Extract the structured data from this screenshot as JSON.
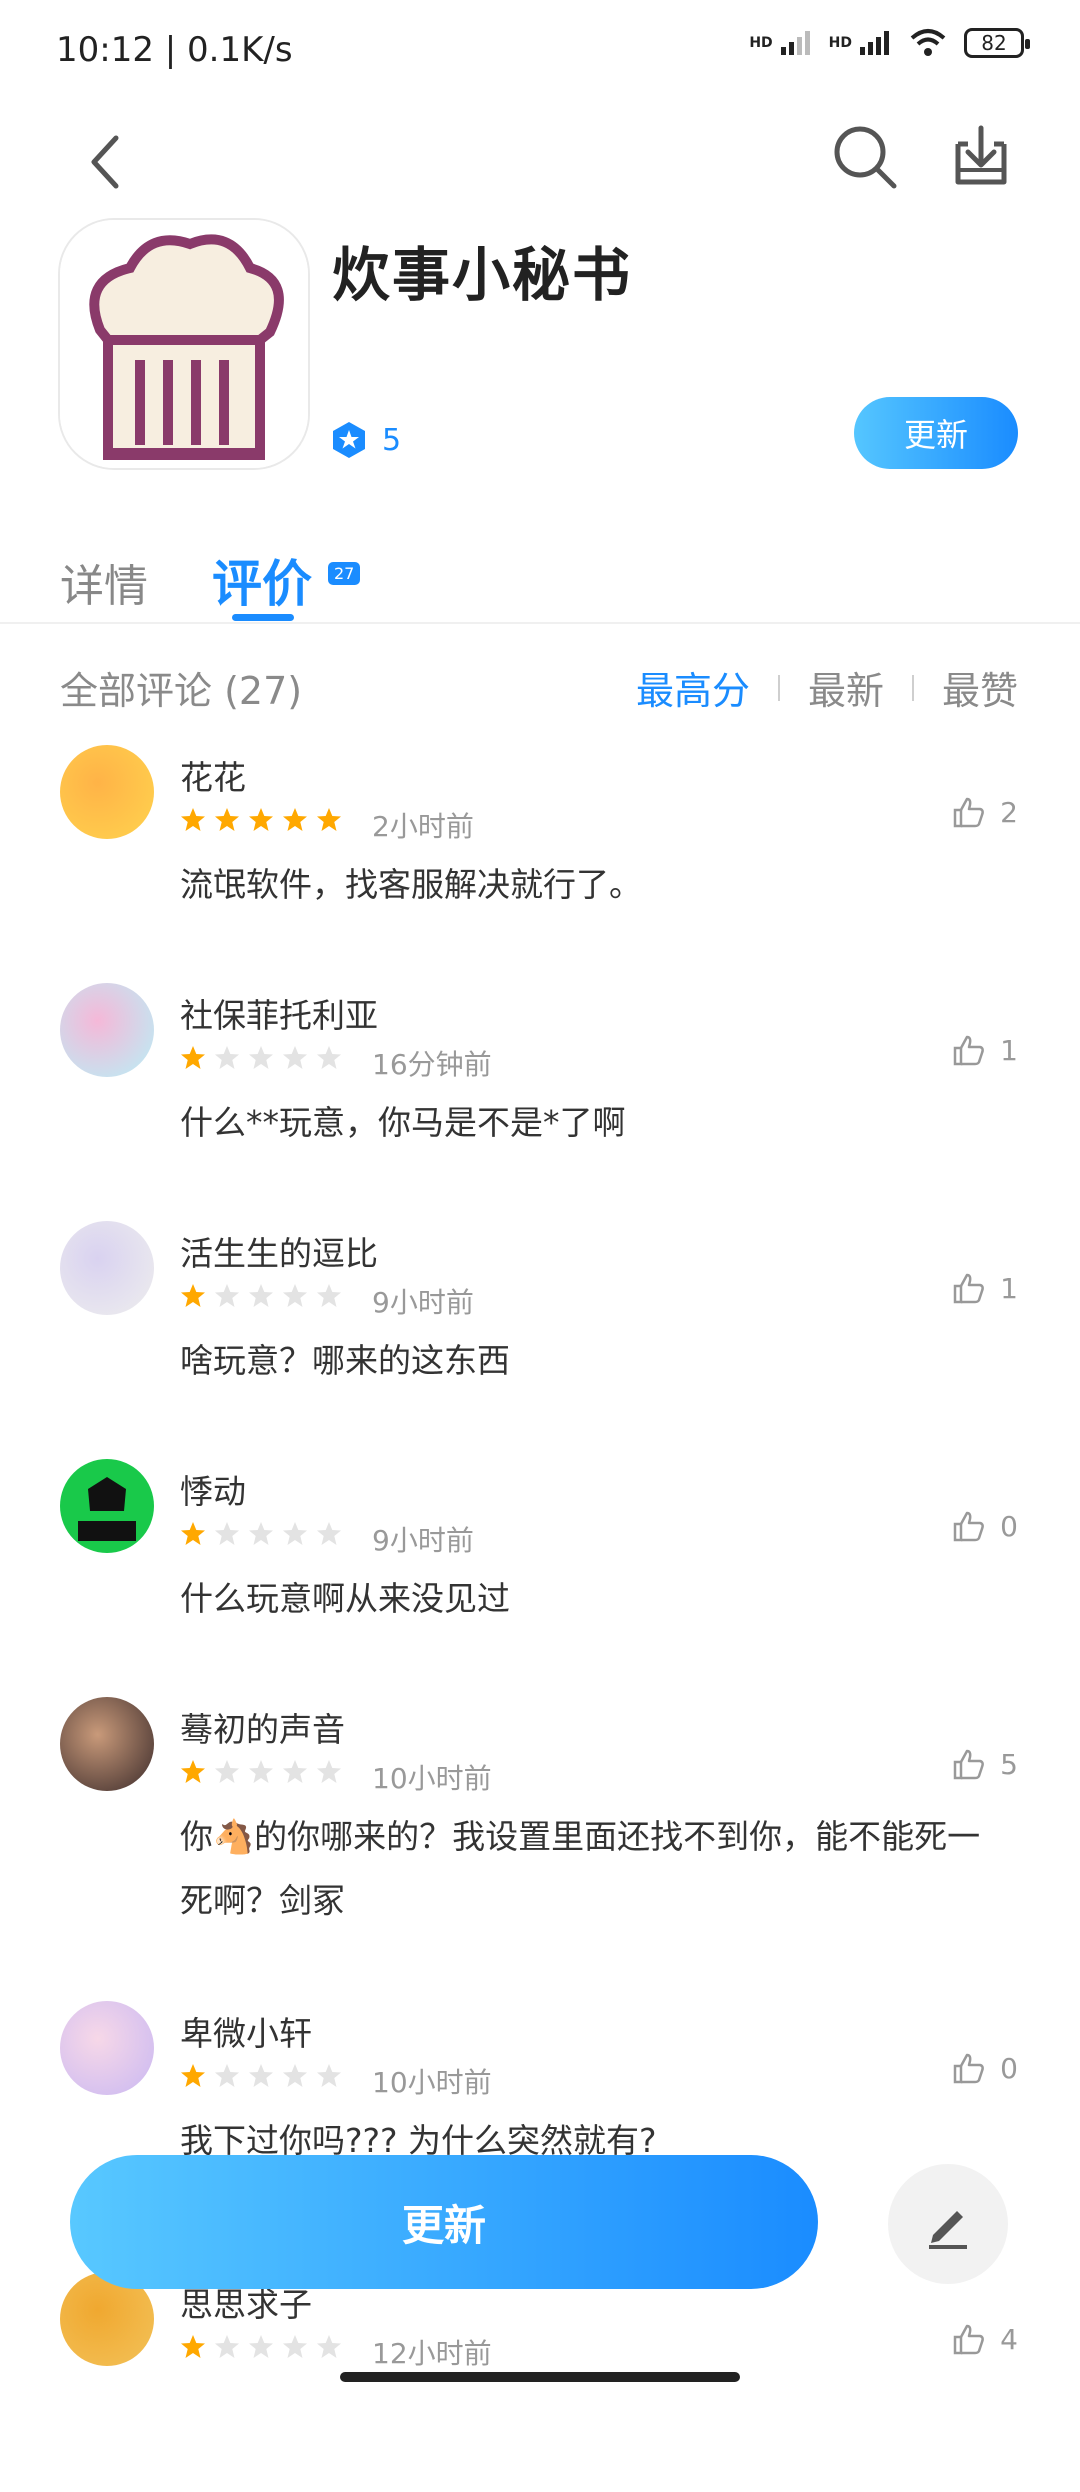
{
  "status_bar": {
    "time": "10:12 | 0.1K/s",
    "battery": "82",
    "hd1": "HD",
    "hd2": "HD"
  },
  "app": {
    "name": "炊事小秘书",
    "rating_badge": "5",
    "update_label": "更新"
  },
  "tabs": {
    "detail": "详情",
    "review": "评价",
    "review_count": "27"
  },
  "filters": {
    "all_label": "全部评论 (27)",
    "options": [
      "最高分",
      "最新",
      "最赞"
    ],
    "active": "最高分"
  },
  "reviews": [
    {
      "name": "花花",
      "stars": 5,
      "time": "2小时前",
      "content": "流氓软件，找客服解决就行了。",
      "likes": "2"
    },
    {
      "name": "社保菲托利亚",
      "stars": 1,
      "time": "16分钟前",
      "content": "什么**玩意，你马是不是*了啊",
      "likes": "1"
    },
    {
      "name": "活生生的逗比",
      "stars": 1,
      "time": "9小时前",
      "content": "啥玩意？哪来的这东西",
      "likes": "1"
    },
    {
      "name": "悸动",
      "stars": 1,
      "time": "9小时前",
      "content": "什么玩意啊从来没见过",
      "likes": "0"
    },
    {
      "name": "蓦初的声音",
      "stars": 1,
      "time": "10小时前",
      "content": "你🐴的你哪来的？我设置里面还找不到你，能不能死一死啊？剑冢",
      "likes": "5"
    },
    {
      "name": "卑微小轩",
      "stars": 1,
      "time": "10小时前",
      "content": "我下过你吗??? 为什么突然就有?",
      "likes": "0"
    },
    {
      "name": "思思求子",
      "stars": 1,
      "time": "12小时前",
      "content": "",
      "likes": "4"
    }
  ],
  "bottom": {
    "update_label": "更新"
  },
  "colors": {
    "accent": "#1a8cff",
    "star": "#ffa800"
  }
}
